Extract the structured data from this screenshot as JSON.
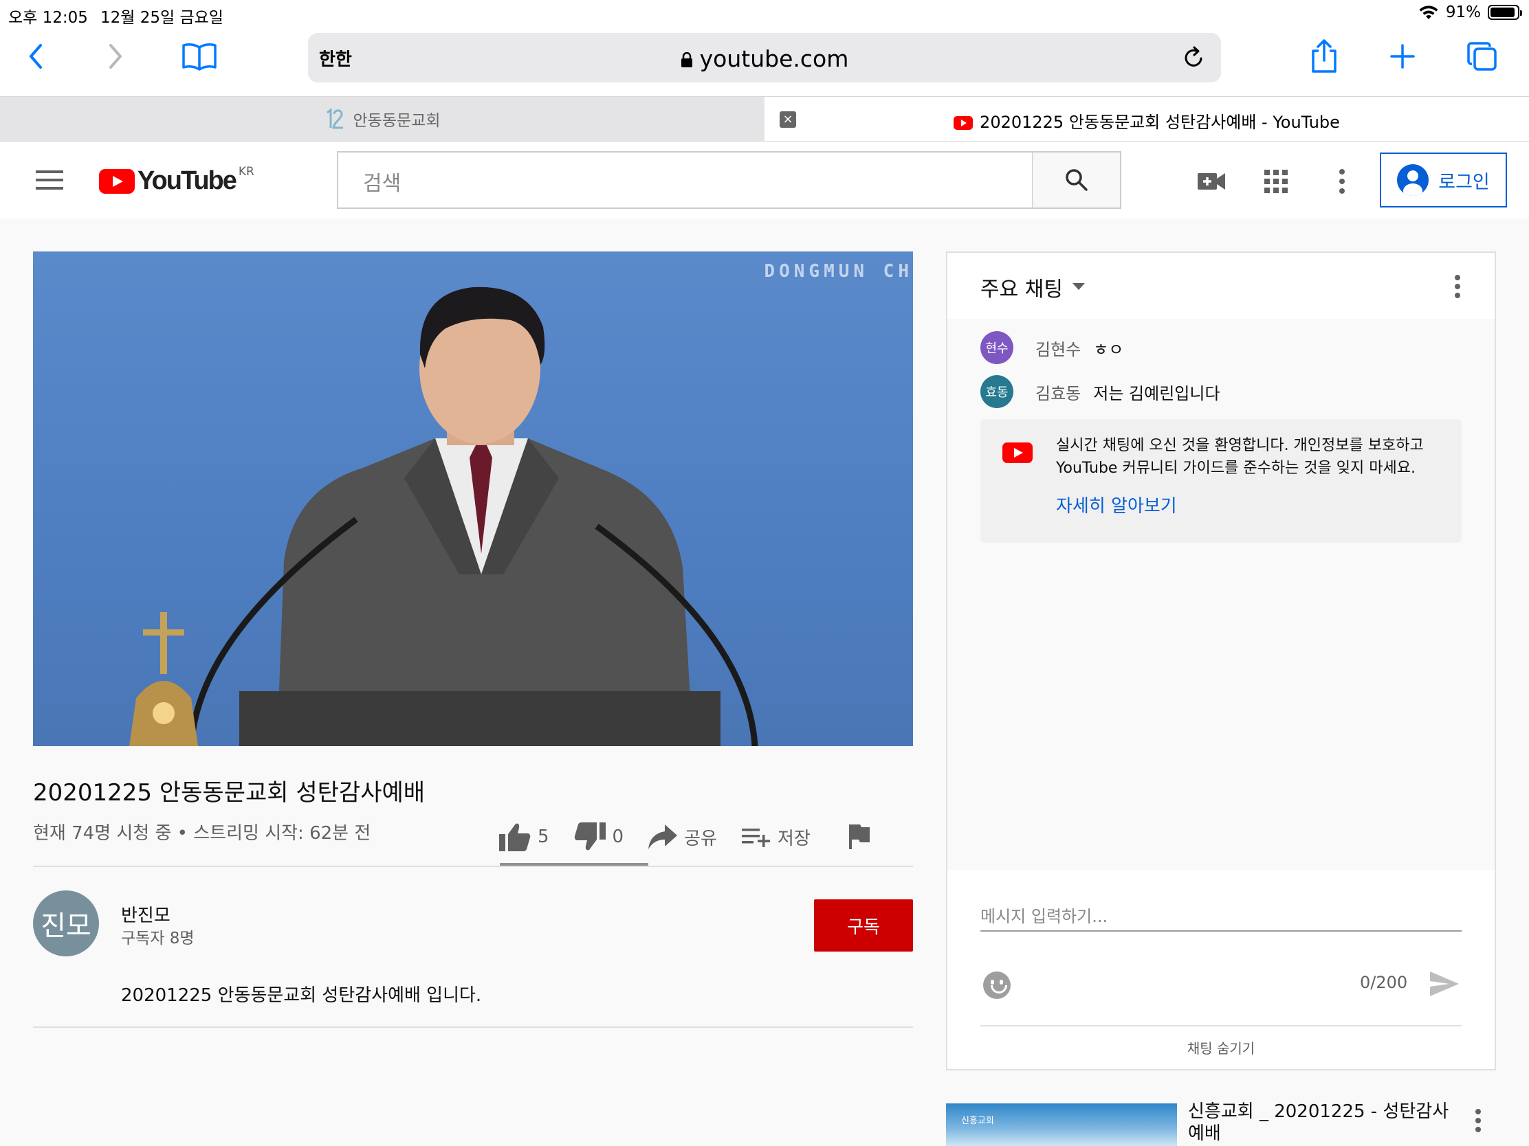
{
  "status_bar": {
    "time": "오후 12:05",
    "date": "12월 25일 금요일",
    "battery": "91%",
    "battery_level": 0.91
  },
  "browser": {
    "aa_label": "한한",
    "url": "youtube.com",
    "tabs": [
      {
        "title": "안동동문교회",
        "active": false
      },
      {
        "title": "20201225 안동동문교회 성탄감사예배 - YouTube",
        "active": true
      }
    ],
    "tab_close": "×"
  },
  "masthead": {
    "logo_text": "YouTube",
    "region": "KR",
    "search_placeholder": "검색",
    "login_label": "로그인",
    "accent": "#065fd4"
  },
  "video": {
    "watermark": "DONGMUN CH",
    "title": "20201225 안동동문교회 성탄감사예배",
    "meta": "현재 74명 시청 중 • 스트리밍 시작: 62분 전",
    "likes": "5",
    "dislikes": "0",
    "share_label": "공유",
    "save_label": "저장"
  },
  "channel": {
    "avatar_text": "진모",
    "name": "반진모",
    "subscribers": "구독자 8명",
    "subscribe_label": "구독",
    "description": "20201225 안동동문교회 성탄감사예배 입니다."
  },
  "chat": {
    "header": "주요 채팅",
    "messages": [
      {
        "avatar": "현수",
        "avatar_color": "#7e57c2",
        "author": "김현수",
        "text": "ㅎㅇ"
      },
      {
        "avatar": "효동",
        "avatar_color": "#26798e",
        "author": "김효동",
        "text": "저는 김예린입니다"
      }
    ],
    "welcome_text": "실시간 채팅에 오신 것을 환영합니다. 개인정보를 보호하고 YouTube 커뮤니티 가이드를 준수하는 것을 잊지 마세요.",
    "welcome_link": "자세히 알아보기",
    "input_placeholder": "메시지 입력하기...",
    "counter": "0/200",
    "hide_label": "채팅 숨기기"
  },
  "up_next": {
    "thumb_text": "신흥교회",
    "title": "신흥교회 _ 20201225 - 성탄감사예배"
  }
}
